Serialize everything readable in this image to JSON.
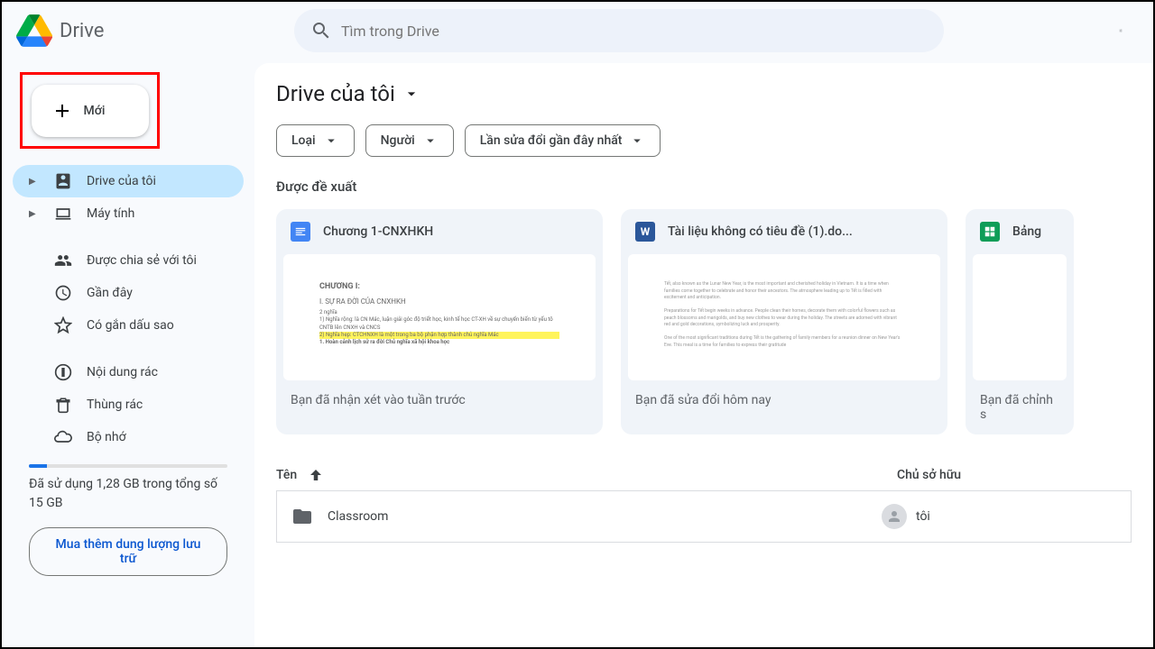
{
  "header": {
    "app_name": "Drive",
    "search_placeholder": "Tìm trong Drive"
  },
  "sidebar": {
    "new_label": "Mới",
    "items": [
      {
        "label": "Drive của tôi",
        "icon": "drive",
        "expandable": true,
        "active": true
      },
      {
        "label": "Máy tính",
        "icon": "computer",
        "expandable": true,
        "active": false
      },
      {
        "label": "Được chia sẻ với tôi",
        "icon": "shared",
        "expandable": false,
        "active": false
      },
      {
        "label": "Gần đây",
        "icon": "recent",
        "expandable": false,
        "active": false
      },
      {
        "label": "Có gắn dấu sao",
        "icon": "star",
        "expandable": false,
        "active": false
      },
      {
        "label": "Nội dung rác",
        "icon": "spam",
        "expandable": false,
        "active": false
      },
      {
        "label": "Thùng rác",
        "icon": "trash",
        "expandable": false,
        "active": false
      },
      {
        "label": "Bộ nhớ",
        "icon": "storage",
        "expandable": false,
        "active": false
      }
    ],
    "storage_text": "Đã sử dụng 1,28 GB trong tổng số 15 GB",
    "buy_storage": "Mua thêm dung lượng lưu trữ"
  },
  "main": {
    "title": "Drive của tôi",
    "filters": [
      {
        "label": "Loại"
      },
      {
        "label": "Người"
      },
      {
        "label": "Lần sửa đổi gần đây nhất"
      }
    ],
    "suggested_title": "Được đề xuất",
    "suggested": [
      {
        "title": "Chương 1-CNXHKH",
        "icon": "docs",
        "icon_color": "#4285f4",
        "subtitle": "Bạn đã nhận xét vào tuần trước",
        "thumb_title": "CHƯƠNG I:",
        "thumb_sub": "I. SỰ RA ĐỜI CỦA CNXHKH"
      },
      {
        "title": "Tài liệu không có tiêu đề (1).do...",
        "icon": "word",
        "icon_color": "#2b579a",
        "subtitle": "Bạn đã sửa đổi hôm nay",
        "thumb_title": "",
        "thumb_sub": ""
      },
      {
        "title": "Bảng",
        "icon": "sheets",
        "icon_color": "#0f9d58",
        "subtitle": "Bạn đã chỉnh s",
        "thumb_title": "",
        "thumb_sub": ""
      }
    ],
    "columns": {
      "name": "Tên",
      "owner": "Chủ sở hữu"
    },
    "files": [
      {
        "name": "Classroom",
        "owner": "tôi"
      }
    ]
  }
}
